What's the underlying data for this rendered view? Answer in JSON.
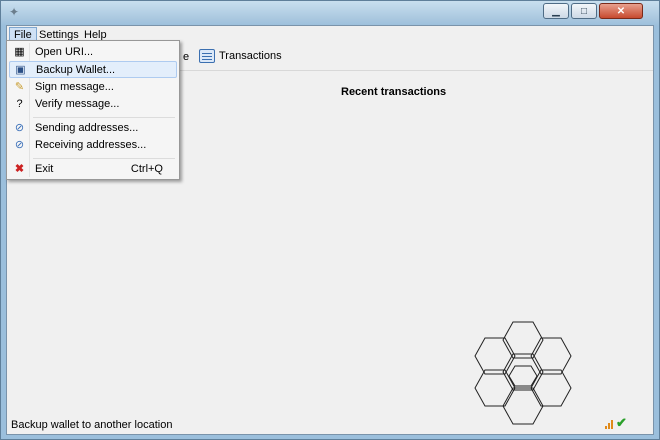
{
  "window": {
    "title": ""
  },
  "menubar": {
    "file": "File",
    "settings": "Settings",
    "help": "Help"
  },
  "toolbar": {
    "partial_label": "e",
    "transactions": "Transactions"
  },
  "main": {
    "section_title": "Recent transactions"
  },
  "file_menu": {
    "items": [
      {
        "label": "Open URI...",
        "icon": "open-uri-icon"
      },
      {
        "label": "Backup Wallet...",
        "icon": "save-icon",
        "highlighted": true
      },
      {
        "label": "Sign message...",
        "icon": "sign-icon"
      },
      {
        "label": "Verify message...",
        "icon": "verify-icon"
      },
      {
        "label": "Sending addresses...",
        "icon": "address-book-icon"
      },
      {
        "label": "Receiving addresses...",
        "icon": "address-book-icon"
      },
      {
        "label": "Exit",
        "icon": "exit-icon",
        "shortcut": "Ctrl+Q"
      }
    ]
  },
  "status": {
    "text": "Backup wallet to another location",
    "sync_ok": true
  },
  "colors": {
    "highlight": "#e3eefb",
    "exit_red": "#cc2222",
    "check_green": "#2aa02a"
  }
}
